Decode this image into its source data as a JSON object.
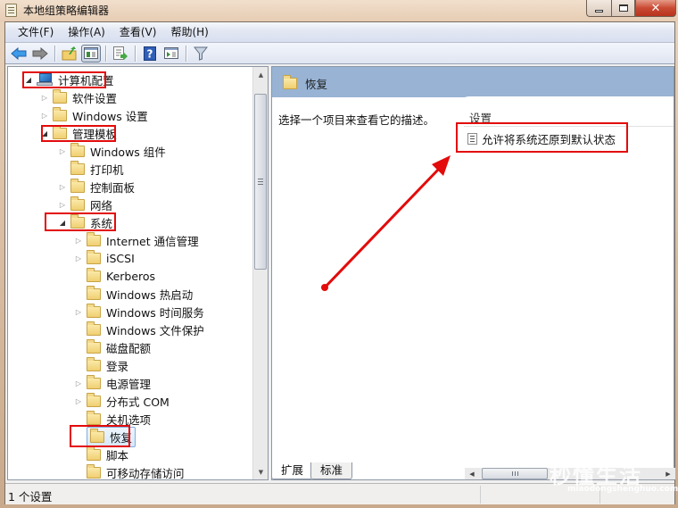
{
  "window": {
    "title": "本地组策略编辑器",
    "controls": {
      "minimize": "minimize",
      "maximize": "maximize",
      "close": "✕"
    }
  },
  "menu": [
    {
      "label": "文件(F)"
    },
    {
      "label": "操作(A)"
    },
    {
      "label": "查看(V)"
    },
    {
      "label": "帮助(H)"
    }
  ],
  "toolbar": [
    {
      "name": "back-icon"
    },
    {
      "name": "forward-icon"
    },
    {
      "name": "up-folder-icon"
    },
    {
      "name": "show-hide-console-tree-icon",
      "pressed": true
    },
    {
      "name": "export-list-icon"
    },
    {
      "name": "help-icon"
    },
    {
      "name": "show-action-pane-icon"
    },
    {
      "name": "filter-icon"
    }
  ],
  "tree": {
    "items": [
      {
        "label": "计算机配置",
        "level": 0,
        "expander": "open",
        "icon": "computer-icon",
        "highlighted": true
      },
      {
        "label": "软件设置",
        "level": 1,
        "expander": "closed",
        "icon": "folder-icon"
      },
      {
        "label": "Windows 设置",
        "level": 1,
        "expander": "closed",
        "icon": "folder-icon"
      },
      {
        "label": "管理模板",
        "level": 1,
        "expander": "open",
        "icon": "folder-icon",
        "highlighted": true
      },
      {
        "label": "Windows 组件",
        "level": 2,
        "expander": "closed",
        "icon": "folder-icon"
      },
      {
        "label": "打印机",
        "level": 2,
        "expander": "none",
        "icon": "folder-icon"
      },
      {
        "label": "控制面板",
        "level": 2,
        "expander": "closed",
        "icon": "folder-icon"
      },
      {
        "label": "网络",
        "level": 2,
        "expander": "closed",
        "icon": "folder-icon"
      },
      {
        "label": "系统",
        "level": 2,
        "expander": "open",
        "icon": "folder-icon",
        "highlighted": true
      },
      {
        "label": "Internet 通信管理",
        "level": 3,
        "expander": "closed",
        "icon": "folder-icon"
      },
      {
        "label": "iSCSI",
        "level": 3,
        "expander": "closed",
        "icon": "folder-icon"
      },
      {
        "label": "Kerberos",
        "level": 3,
        "expander": "none",
        "icon": "folder-icon"
      },
      {
        "label": "Windows 热启动",
        "level": 3,
        "expander": "none",
        "icon": "folder-icon"
      },
      {
        "label": "Windows 时间服务",
        "level": 3,
        "expander": "closed",
        "icon": "folder-icon"
      },
      {
        "label": "Windows 文件保护",
        "level": 3,
        "expander": "none",
        "icon": "folder-icon"
      },
      {
        "label": "磁盘配额",
        "level": 3,
        "expander": "none",
        "icon": "folder-icon"
      },
      {
        "label": "登录",
        "level": 3,
        "expander": "none",
        "icon": "folder-icon"
      },
      {
        "label": "电源管理",
        "level": 3,
        "expander": "closed",
        "icon": "folder-icon"
      },
      {
        "label": "分布式 COM",
        "level": 3,
        "expander": "closed",
        "icon": "folder-icon"
      },
      {
        "label": "关机选项",
        "level": 3,
        "expander": "none",
        "icon": "folder-icon"
      },
      {
        "label": "恢复",
        "level": 3,
        "expander": "none",
        "icon": "folder-icon",
        "selected": true,
        "highlighted": true
      },
      {
        "label": "脚本",
        "level": 3,
        "expander": "none",
        "icon": "folder-icon"
      },
      {
        "label": "可移动存储访问",
        "level": 3,
        "expander": "none",
        "icon": "folder-icon"
      }
    ]
  },
  "right_pane": {
    "header_title": "恢复",
    "description": "选择一个项目来查看它的描述。",
    "column_header": "设置",
    "settings": [
      {
        "label": "允许将系统还原到默认状态",
        "highlighted": true
      }
    ]
  },
  "tabs": [
    {
      "label": "扩展",
      "active": true
    },
    {
      "label": "标准",
      "active": false
    }
  ],
  "status": {
    "text": "1 个设置"
  },
  "watermark": {
    "title": "秒懂生活",
    "url": "miaodongshenghuo.com"
  },
  "annotation": {
    "color": "#e30b0b"
  }
}
